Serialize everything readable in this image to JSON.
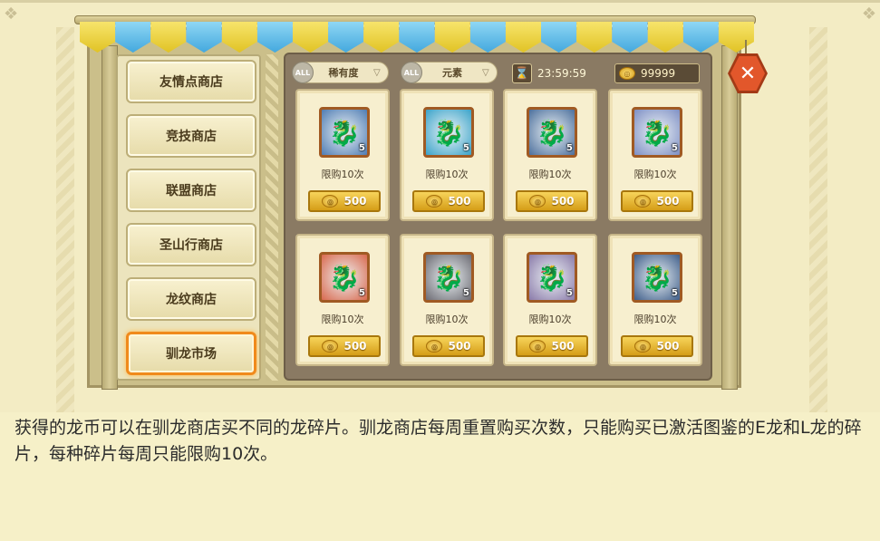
{
  "menu": {
    "items": [
      {
        "label": "友情点商店"
      },
      {
        "label": "竞技商店"
      },
      {
        "label": "联盟商店"
      },
      {
        "label": "圣山行商店"
      },
      {
        "label": "龙纹商店"
      },
      {
        "label": "驯龙市场",
        "active": true
      }
    ]
  },
  "filters": {
    "rarity": {
      "tag": "ALL",
      "label": "稀有度"
    },
    "element": {
      "tag": "ALL",
      "label": "元素"
    }
  },
  "timer": {
    "value": "23:59:59",
    "icon": "hourglass-icon"
  },
  "currency": {
    "value": "99999",
    "icon": "coin-icon"
  },
  "items": [
    {
      "qty": "5",
      "limit": "限购10次",
      "price": "500",
      "color": "#4f7cb3"
    },
    {
      "qty": "5",
      "limit": "限购10次",
      "price": "500",
      "color": "#3aa3c9"
    },
    {
      "qty": "5",
      "limit": "限购10次",
      "price": "500",
      "color": "#4c6f9c"
    },
    {
      "qty": "5",
      "limit": "限购10次",
      "price": "500",
      "color": "#7e8fc4"
    },
    {
      "qty": "5",
      "limit": "限购10次",
      "price": "500",
      "color": "#d9694e"
    },
    {
      "qty": "5",
      "limit": "限购10次",
      "price": "500",
      "color": "#6c6b73"
    },
    {
      "qty": "5",
      "limit": "限购10次",
      "price": "500",
      "color": "#8a7aa9"
    },
    {
      "qty": "5",
      "limit": "限购10次",
      "price": "500",
      "color": "#3f5e8a"
    }
  ],
  "description": "获得的龙币可以在驯龙商店买不同的龙碎片。驯龙商店每周重置购买次数，只能购买已激活图鉴的E龙和L龙的碎片，每种碎片每周只能限购10次。"
}
